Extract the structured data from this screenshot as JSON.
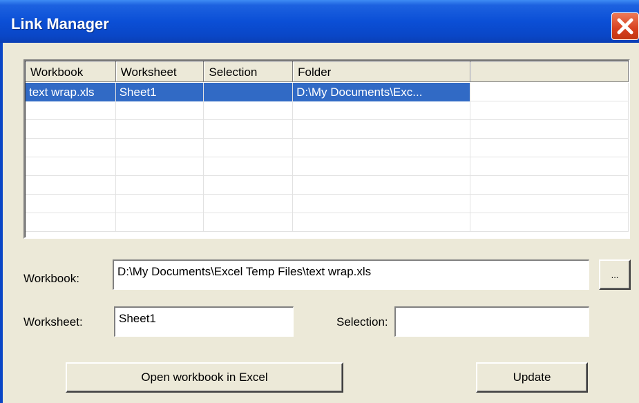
{
  "window": {
    "title": "Link Manager",
    "close_icon": "close-icon"
  },
  "list": {
    "columns": [
      "Workbook",
      "Worksheet",
      "Selection",
      "Folder",
      ""
    ],
    "rows": [
      [
        "text wrap.xls",
        "Sheet1",
        "",
        "D:\\My Documents\\Exc...",
        ""
      ]
    ],
    "empty_rows": 7,
    "selected_row": 0,
    "selection_color": "#316ac5"
  },
  "form": {
    "workbook_label": "Workbook:",
    "workbook_value": "D:\\My Documents\\Excel Temp Files\\text wrap.xls",
    "browse_label": "...",
    "worksheet_label": "Worksheet:",
    "worksheet_value": "Sheet1",
    "selection_label": "Selection:",
    "selection_value": ""
  },
  "buttons": {
    "open_label": "Open workbook in Excel",
    "update_label": "Update"
  }
}
